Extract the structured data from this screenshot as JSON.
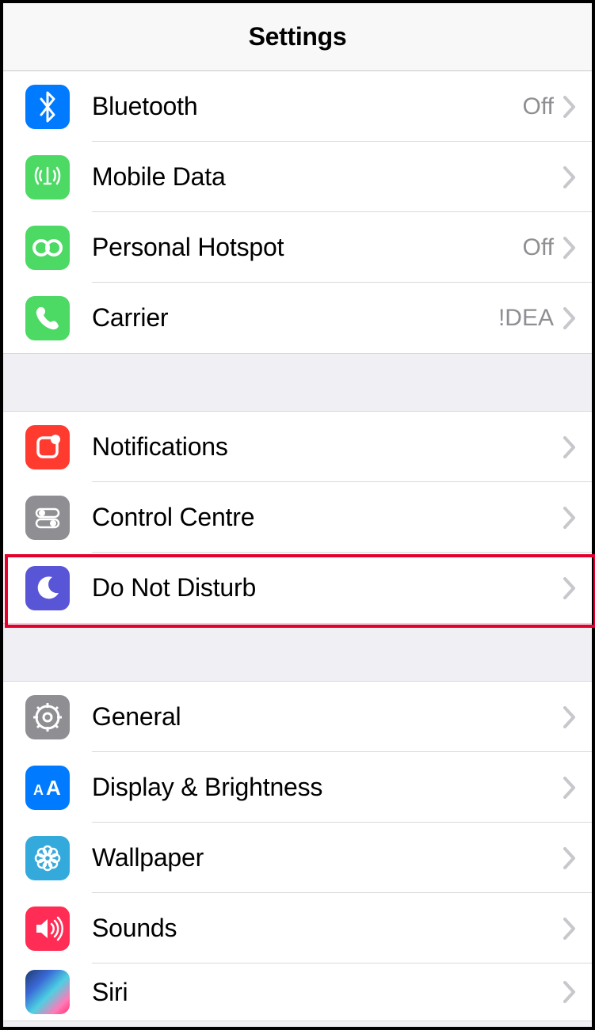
{
  "header": {
    "title": "Settings"
  },
  "group1": [
    {
      "id": "bluetooth",
      "label": "Bluetooth",
      "value": "Off"
    },
    {
      "id": "mobile-data",
      "label": "Mobile Data",
      "value": ""
    },
    {
      "id": "personal-hotspot",
      "label": "Personal Hotspot",
      "value": "Off"
    },
    {
      "id": "carrier",
      "label": "Carrier",
      "value": "!DEA"
    }
  ],
  "group2": [
    {
      "id": "notifications",
      "label": "Notifications",
      "value": ""
    },
    {
      "id": "control-centre",
      "label": "Control Centre",
      "value": ""
    },
    {
      "id": "do-not-disturb",
      "label": "Do Not Disturb",
      "value": ""
    }
  ],
  "group3": [
    {
      "id": "general",
      "label": "General",
      "value": ""
    },
    {
      "id": "display-brightness",
      "label": "Display & Brightness",
      "value": ""
    },
    {
      "id": "wallpaper",
      "label": "Wallpaper",
      "value": ""
    },
    {
      "id": "sounds",
      "label": "Sounds",
      "value": ""
    },
    {
      "id": "siri",
      "label": "Siri",
      "value": ""
    }
  ],
  "highlighted_row": "do-not-disturb",
  "colors": {
    "accent_blue": "#007aff",
    "green": "#4cd964",
    "red": "#ff3b30",
    "gray": "#8e8e93",
    "purple": "#5856d6",
    "cyan": "#34aadc",
    "pink": "#ff2d55",
    "highlight": "#e4002b"
  }
}
